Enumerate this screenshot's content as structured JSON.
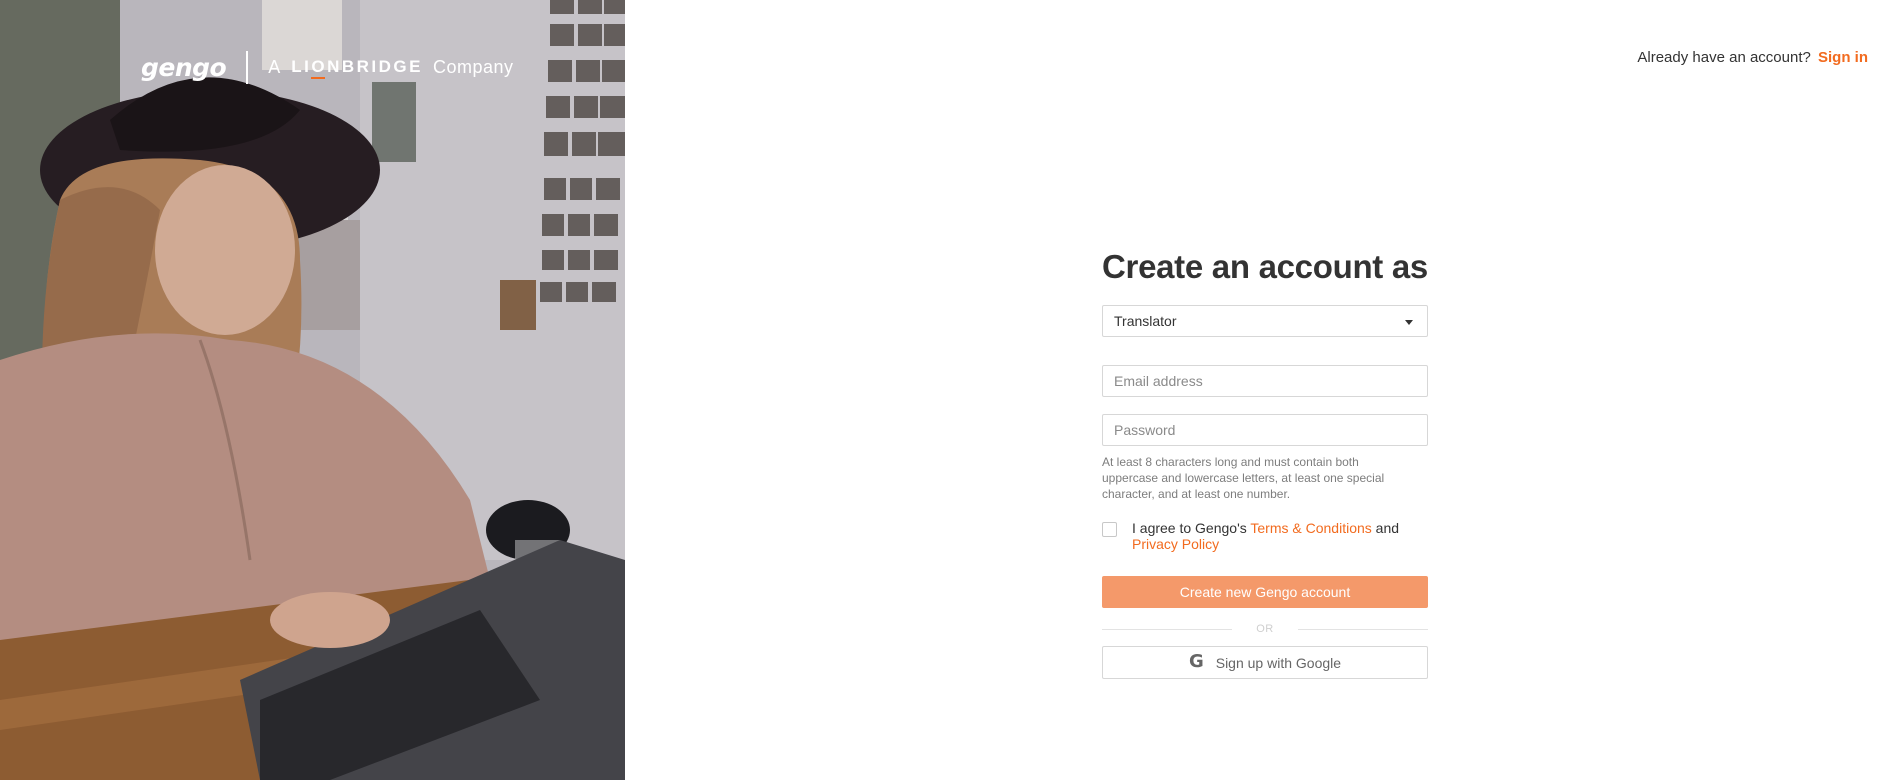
{
  "brand": {
    "logo_text": "gengo",
    "prefix": "A",
    "company_name": "LIONBRIDGE",
    "suffix": "Company",
    "accent_color": "#f26b1f"
  },
  "header": {
    "prompt": "Already have an account?",
    "signin_label": "Sign in"
  },
  "form": {
    "title": "Create an account as",
    "account_type": {
      "selected": "Translator"
    },
    "email": {
      "placeholder": "Email address",
      "value": ""
    },
    "password": {
      "placeholder": "Password",
      "value": ""
    },
    "password_hint": "At least 8 characters long and must contain both uppercase and lowercase letters, at least one special character, and at least one number.",
    "agree": {
      "checked": false,
      "text": "I agree to Gengo's",
      "terms_link": "Terms & Conditions",
      "connector": "and",
      "privacy_link": "Privacy Policy"
    },
    "submit_label": "Create new Gengo account",
    "submit_color": "#f4996a",
    "divider_text": "OR",
    "google_label": "Sign up with Google",
    "google_icon": "google-g-icon"
  }
}
